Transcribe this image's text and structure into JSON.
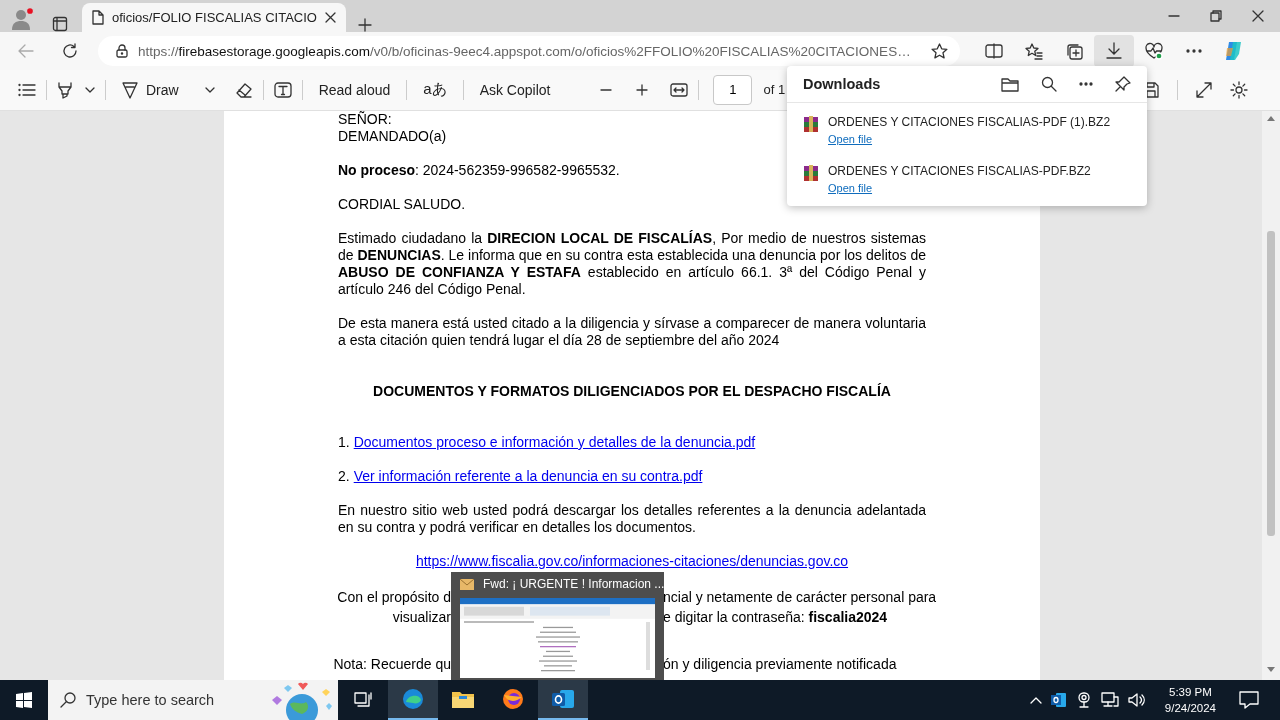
{
  "tabs": [
    {
      "title": "oficios/FOLIO FISCALIAS CITACIO",
      "selected": true
    }
  ],
  "address": {
    "scheme": "https://",
    "host": "firebasestorage.googleapis.com",
    "path": "/v0/b/oficinas-9eec4.appspot.com/o/oficios%2FFOLIO%20FISCALIAS%20CITACIONES…"
  },
  "browser_toolbar": {
    "downloads_selected": true
  },
  "pdf_toolbar": {
    "draw": "Draw",
    "read_aloud": "Read aloud",
    "translate": "aあ",
    "ask": "Ask Copilot",
    "page": "1",
    "page_count": "of 1"
  },
  "downloads": {
    "title": "Downloads",
    "items": [
      {
        "name": "ORDENES Y CITACIONES FISCALIAS-PDF (1).BZ2",
        "action": "Open file"
      },
      {
        "name": "ORDENES Y CITACIONES FISCALIAS-PDF.BZ2",
        "action": "Open file"
      }
    ]
  },
  "document": {
    "blocks": [
      {
        "kind": "line",
        "text": "SEÑOR:"
      },
      {
        "kind": "line",
        "text": "DEMANDADO(a)"
      },
      {
        "kind": "para",
        "text": "**No proceso**: 2024-562359-996582-9965532."
      },
      {
        "kind": "para",
        "text": "CORDIAL SALUDO."
      },
      {
        "kind": "para",
        "text": "Estimado ciudadano la **DIRECION LOCAL DE FISCALÍAS**, Por medio de nuestros sistemas de **DENUNCIAS**. Le informa que en su contra esta establecida una denuncia por los delitos de **ABUSO DE CONFIANZA Y ESTAFA** establecido en artículo 66.1. 3ª del Código Penal y artículo 246 del Código Penal."
      },
      {
        "kind": "para",
        "text": "De esta manera está usted citado a la diligencia y sírvase a comparecer de manera voluntaria a esta citación quien tendrá lugar el día 28 de septiembre del año 2024"
      },
      {
        "kind": "heading",
        "text": "DOCUMENTOS Y FORMATOS DILIGENCIADOS POR EL DESPACHO FISCALÍA"
      },
      {
        "kind": "link_item",
        "number": "1.",
        "link": "Documentos proceso e información y detalles de la denuncia.pdf"
      },
      {
        "kind": "link_item",
        "number": "2.",
        "link": "Ver información referente a la denuncia en su contra.pdf"
      },
      {
        "kind": "para",
        "text": "En nuestro sitio web usted podrá descargar los detalles referentes a la denuncia adelantada en su contra y podrá verificar en detalles los documentos."
      },
      {
        "kind": "url",
        "link": "https://www.fiscalia.gov.co/informaciones-citaciones/denuncias.gov.co"
      },
      {
        "kind": "split",
        "left": "Con el propósito d",
        "right": "ncial y netamente de carácter personal para"
      },
      {
        "kind": "split",
        "left": "visualizar",
        "right": "e digitar la contraseña: **fiscalia2024**"
      },
      {
        "kind": "split_gap",
        "left": "Nota: Recuerde qu",
        "right": "ón y diligencia previamente notificada"
      }
    ]
  },
  "preview": {
    "title": "Fwd: ¡ URGENTE ! Informacion ..."
  },
  "taskbar": {
    "search_placeholder": "Type here to search",
    "apps": [
      {
        "kind": "edge",
        "running": true,
        "highlighted": true
      },
      {
        "kind": "files",
        "running": false,
        "highlighted": false
      },
      {
        "kind": "firefox",
        "running": false,
        "highlighted": false
      },
      {
        "kind": "mail",
        "running": true,
        "highlighted": true
      }
    ],
    "time": "5:39 PM",
    "date": "9/24/2024"
  }
}
